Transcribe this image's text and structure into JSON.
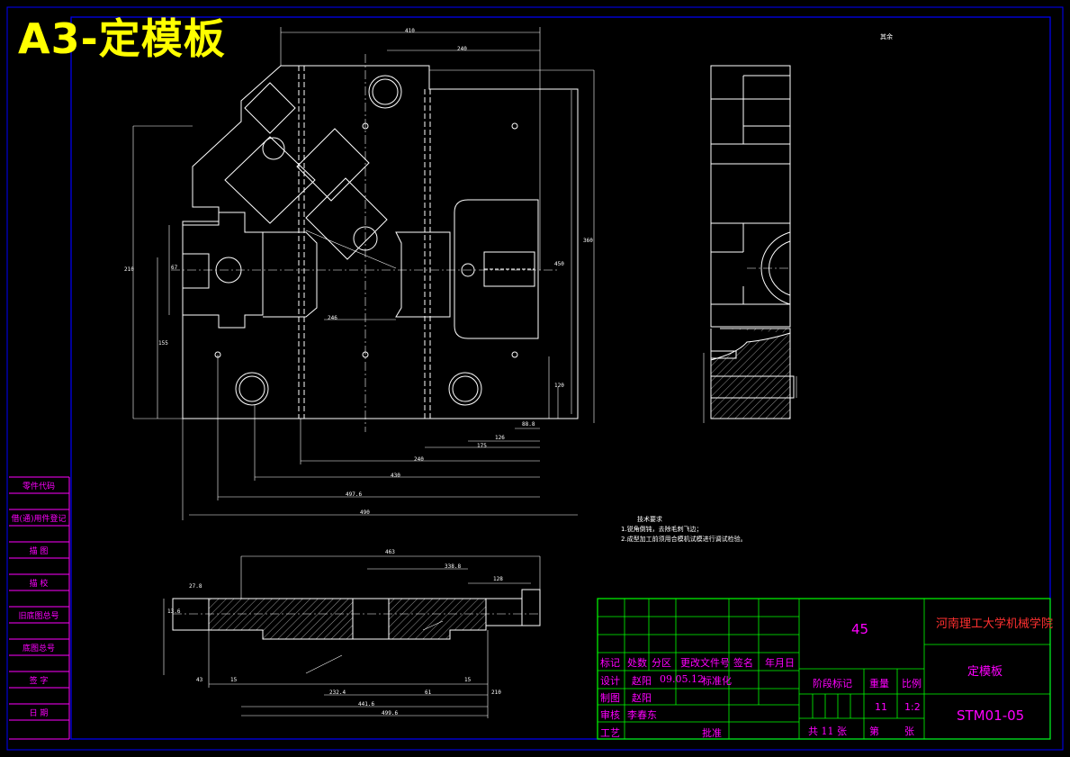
{
  "drawing_title": "A3-定模板",
  "side_labels": [
    "零件代码",
    "借(通)用件登记",
    "描 图",
    "描 校",
    "旧底图总号",
    "底图总号",
    "签 字",
    "日 期"
  ],
  "view_label": "其余",
  "technical_notes": {
    "title": "技术要求",
    "items": [
      "1.锐角倒钝，去除毛刺飞边；",
      "2.成型加工前须用合模机试模进行调试检验。"
    ]
  },
  "dimensions": {
    "top_view": [
      "410",
      "240",
      "210",
      "360",
      "88.8",
      "126",
      "175",
      "240",
      "430",
      "497.6",
      "490",
      "120",
      "155",
      "246",
      "67",
      "450"
    ],
    "front_view": [
      "463",
      "338.8",
      "128",
      "27.8",
      "13.6",
      "15",
      "232.4",
      "61",
      "441.6",
      "499.6",
      "210",
      "15",
      "43"
    ]
  },
  "title_block": {
    "material": "45",
    "school": "河南理工大学机械学院",
    "part_name": "定模板",
    "drawing_number": "STM01-05",
    "headers": [
      "标记",
      "处数",
      "分区",
      "更改文件号",
      "签名",
      "年月日"
    ],
    "rows": [
      {
        "role": "设计",
        "name": "赵阳",
        "date": "09.05.12",
        "std": "标准化"
      },
      {
        "role": "制图",
        "name": "赵阳",
        "date": "",
        "std": ""
      },
      {
        "role": "审核",
        "name": "李春东",
        "date": "",
        "std": ""
      },
      {
        "role": "工艺",
        "name": "",
        "date": "",
        "std": "批准"
      }
    ],
    "stage_label": "阶段标记",
    "weight_label": "重量",
    "scale_label": "比例",
    "weight_value": "11",
    "scale_value": "1:2",
    "sheets_total": "共 11 张",
    "sheet_no": "第",
    "sheet_unit": "张"
  },
  "colors": {
    "background": "#000000",
    "frame": "#0000ff",
    "geometry": "#ffffff",
    "side_table": "#ff00ff",
    "title_grid": "#00ff00",
    "title_text": "#ff00ff",
    "title_accent": "#ff3030",
    "title_big": "#ffff00"
  }
}
